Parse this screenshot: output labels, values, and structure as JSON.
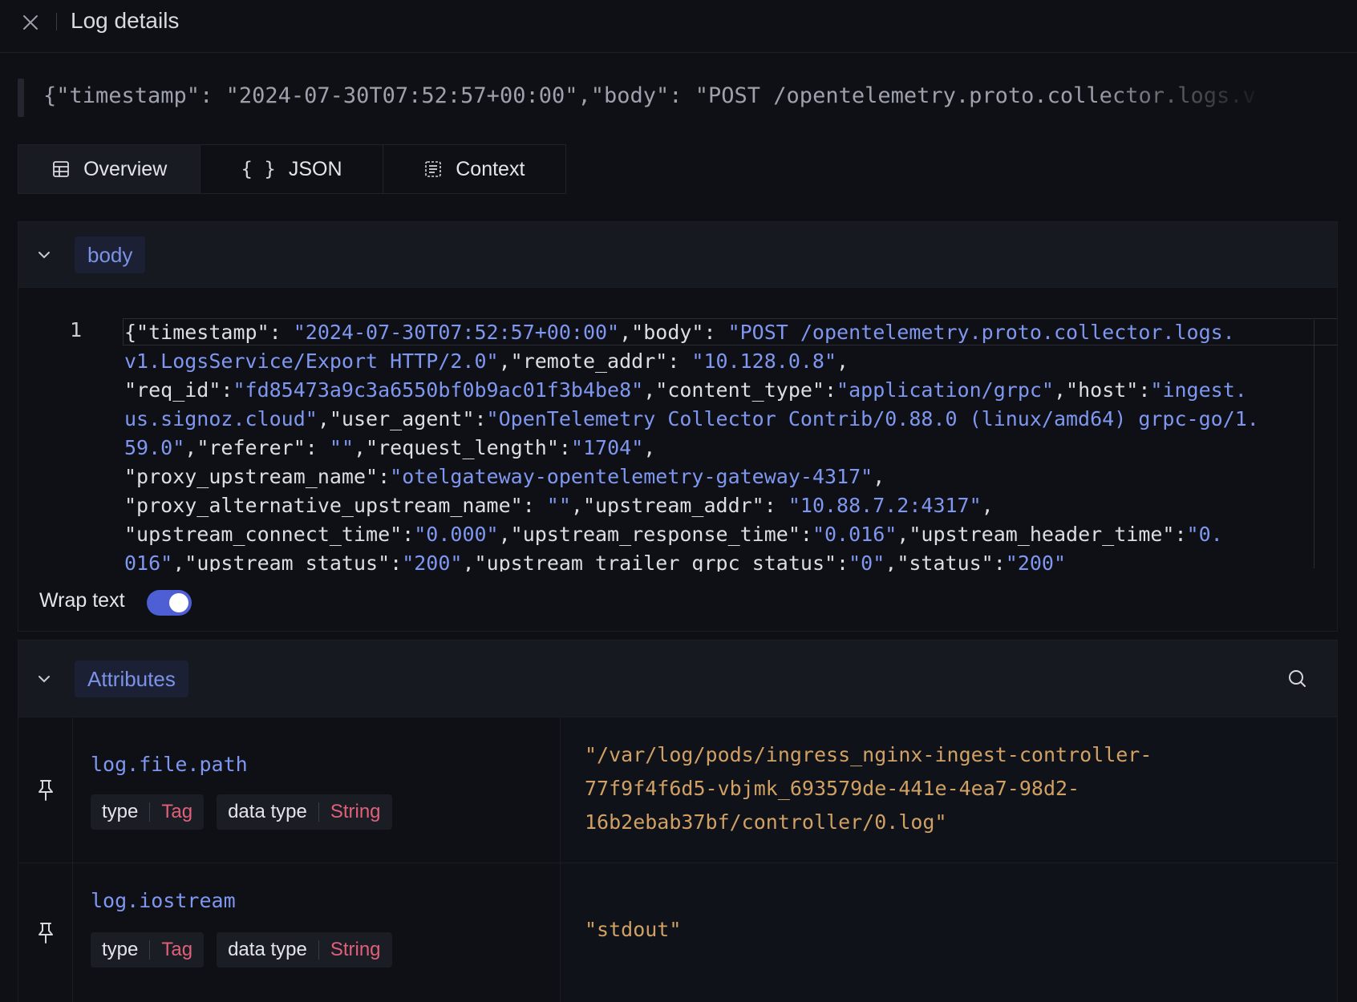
{
  "header": {
    "title": "Log details",
    "close_icon": "close-icon"
  },
  "raw_line": "{\"timestamp\": \"2024-07-30T07:52:57+00:00\",\"body\": \"POST /opentelemetry.proto.collector.logs.v",
  "tabs": [
    {
      "label": "Overview",
      "icon": "table-icon",
      "active": true
    },
    {
      "label": "JSON",
      "icon": "braces-icon",
      "active": false
    },
    {
      "label": "Context",
      "icon": "list-icon",
      "active": false
    }
  ],
  "body_section": {
    "title": "body",
    "line_number": "1",
    "wrap_text_label": "Wrap text",
    "wrap_text_enabled": true
  },
  "attributes_section": {
    "title": "Attributes",
    "rows": [
      {
        "key": "log.file.path",
        "type_label": "type",
        "type_value": "Tag",
        "data_type_label": "data type",
        "data_type_value": "String",
        "value_lines": [
          "\"/var/log/pods/ingress_nginx-ingest-controller-",
          "77f9f4f6d5-vbjmk_693579de-441e-4ea7-98d2-",
          "16b2ebab37bf/controller/0.log\""
        ]
      },
      {
        "key": "log.iostream",
        "type_label": "type",
        "type_value": "Tag",
        "data_type_label": "data type",
        "data_type_value": "String",
        "value_lines": [
          "\"stdout\""
        ]
      }
    ]
  },
  "colors": {
    "accent": "#4e5fd6",
    "key_blue": "#7f97f0",
    "tag_red": "#e0607a",
    "value_orange": "#d1a064",
    "background": "#0e1015"
  }
}
